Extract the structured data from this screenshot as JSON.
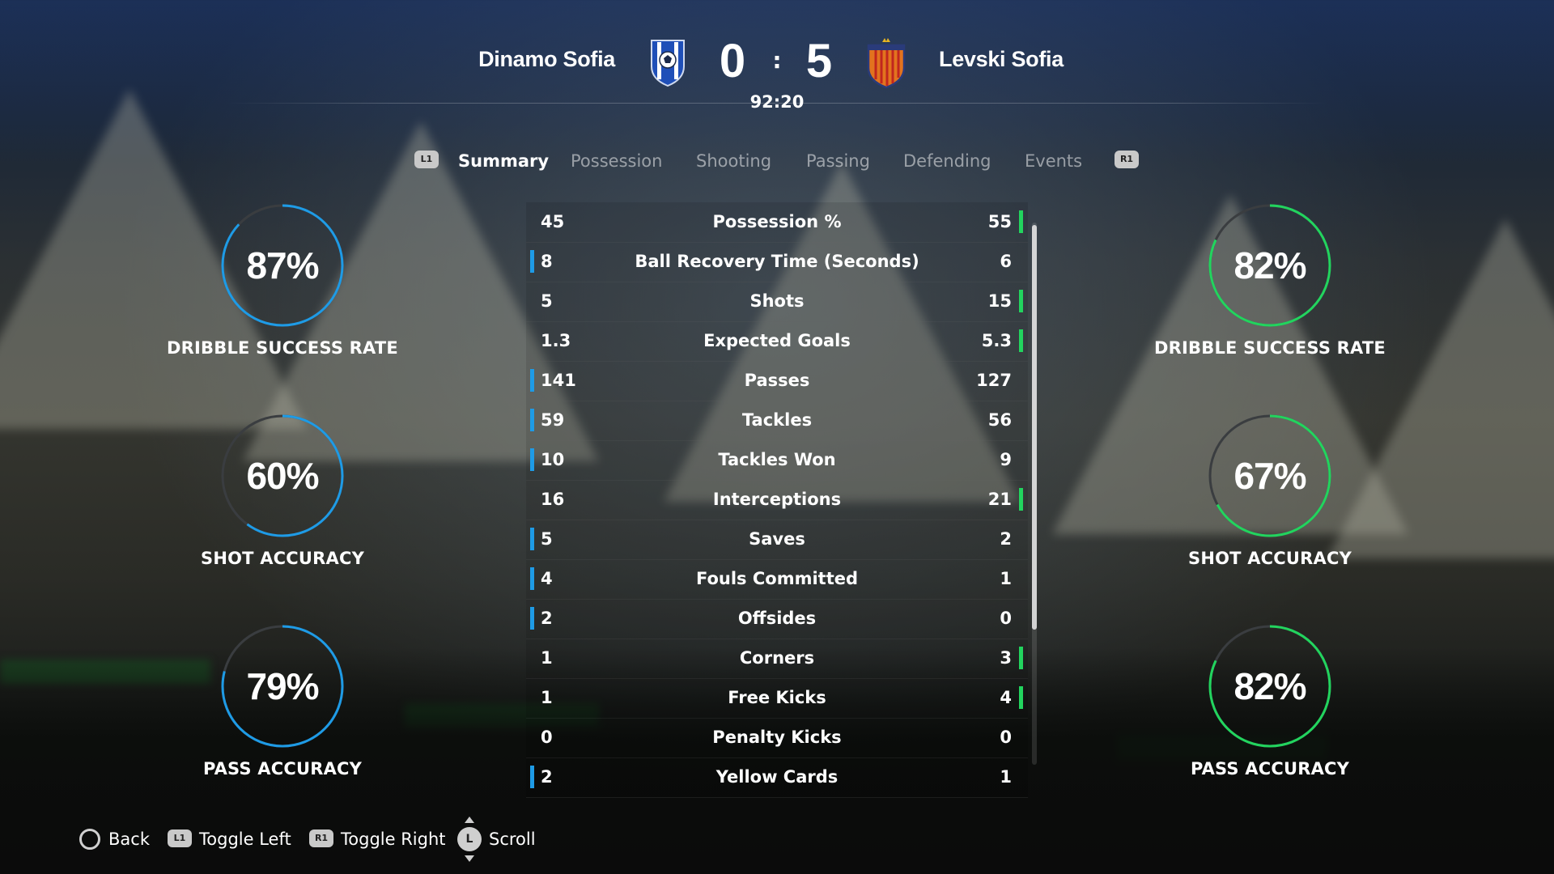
{
  "match": {
    "home_team": "Dinamo Sofia",
    "away_team": "Levski Sofia",
    "home_score": "0",
    "separator": ":",
    "away_score": "5",
    "clock": "92:20"
  },
  "tabs": {
    "left_button": "L1",
    "right_button": "R1",
    "items": [
      "Summary",
      "Possession",
      "Shooting",
      "Passing",
      "Defending",
      "Events"
    ],
    "active": "Summary"
  },
  "home_rings": [
    {
      "value": "87%",
      "label": "DRIBBLE SUCCESS RATE",
      "fraction": 0.87
    },
    {
      "value": "60%",
      "label": "SHOT ACCURACY",
      "fraction": 0.6
    },
    {
      "value": "79%",
      "label": "PASS ACCURACY",
      "fraction": 0.79
    }
  ],
  "away_rings": [
    {
      "value": "82%",
      "label": "DRIBBLE SUCCESS RATE",
      "fraction": 0.82
    },
    {
      "value": "67%",
      "label": "SHOT ACCURACY",
      "fraction": 0.67
    },
    {
      "value": "82%",
      "label": "PASS ACCURACY",
      "fraction": 0.82
    }
  ],
  "stats": [
    {
      "label": "Possession %",
      "home": "45",
      "away": "55",
      "leader": "away"
    },
    {
      "label": "Ball Recovery Time (Seconds)",
      "home": "8",
      "away": "6",
      "leader": "home"
    },
    {
      "label": "Shots",
      "home": "5",
      "away": "15",
      "leader": "away"
    },
    {
      "label": "Expected Goals",
      "home": "1.3",
      "away": "5.3",
      "leader": "away"
    },
    {
      "label": "Passes",
      "home": "141",
      "away": "127",
      "leader": "home"
    },
    {
      "label": "Tackles",
      "home": "59",
      "away": "56",
      "leader": "home"
    },
    {
      "label": "Tackles Won",
      "home": "10",
      "away": "9",
      "leader": "home"
    },
    {
      "label": "Interceptions",
      "home": "16",
      "away": "21",
      "leader": "away"
    },
    {
      "label": "Saves",
      "home": "5",
      "away": "2",
      "leader": "home"
    },
    {
      "label": "Fouls Committed",
      "home": "4",
      "away": "1",
      "leader": "home"
    },
    {
      "label": "Offsides",
      "home": "2",
      "away": "0",
      "leader": "home"
    },
    {
      "label": "Corners",
      "home": "1",
      "away": "3",
      "leader": "away"
    },
    {
      "label": "Free Kicks",
      "home": "1",
      "away": "4",
      "leader": "away"
    },
    {
      "label": "Penalty Kicks",
      "home": "0",
      "away": "0",
      "leader": "none"
    },
    {
      "label": "Yellow Cards",
      "home": "2",
      "away": "1",
      "leader": "home"
    }
  ],
  "colors": {
    "home_accent": "#1e9be6",
    "away_accent": "#22d45e",
    "ring_track": "#3a3d40"
  },
  "footer": {
    "back_label": "Back",
    "toggle_left_button": "L1",
    "toggle_left_label": "Toggle Left",
    "toggle_right_button": "R1",
    "toggle_right_label": "Toggle Right",
    "scroll_button": "L",
    "scroll_label": "Scroll"
  }
}
